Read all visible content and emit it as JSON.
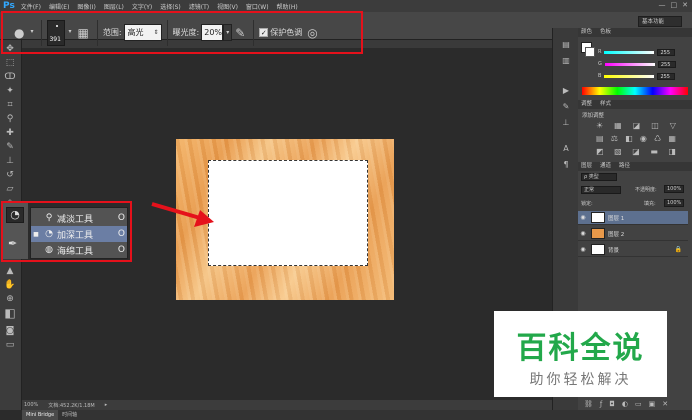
{
  "app": {
    "logo": "Ps"
  },
  "menu": [
    "文件(F)",
    "编辑(E)",
    "图像(I)",
    "图层(L)",
    "文字(Y)",
    "选择(S)",
    "滤镜(T)",
    "视图(V)",
    "窗口(W)",
    "帮助(H)"
  ],
  "window_controls": [
    "—",
    "□",
    "✕"
  ],
  "workspace": "基本功能",
  "options": {
    "brush_size": "391",
    "range_label": "范围:",
    "range_value": "高光",
    "exposure_label": "曝光度:",
    "exposure_value": "20%",
    "protect_tones_checked": true,
    "protect_tones_label": "保护色调"
  },
  "flyout": {
    "items": [
      {
        "label": "减淡工具",
        "key": "O",
        "icon": "dodge-icon",
        "active": false
      },
      {
        "label": "加深工具",
        "key": "O",
        "icon": "burn-icon",
        "active": true
      },
      {
        "label": "海绵工具",
        "key": "O",
        "icon": "sponge-icon",
        "active": false
      }
    ]
  },
  "color_panel": {
    "tabs": [
      "颜色",
      "色板"
    ],
    "r_label": "R",
    "g_label": "G",
    "b_label": "B",
    "r": "255",
    "g": "255",
    "b": "255"
  },
  "adjust_panel": {
    "tabs": [
      "调整",
      "样式"
    ],
    "add_label": "添加调整"
  },
  "layers_panel": {
    "tabs": [
      "图层",
      "通道",
      "路径"
    ],
    "filter": "ρ 类型",
    "blend_mode": "正常",
    "opacity_label": "不透明度:",
    "opacity": "100%",
    "lock_label": "锁定:",
    "fill_label": "填充:",
    "fill": "100%",
    "layers": [
      {
        "name": "图层 1",
        "selected": true,
        "thumb": "#ffffff"
      },
      {
        "name": "图层 2",
        "selected": false,
        "thumb": "#e8994a"
      },
      {
        "name": "背景",
        "selected": false,
        "thumb": "#ffffff"
      }
    ]
  },
  "status": {
    "zoom": "100%",
    "doc": "文档:452.2K/1.18M"
  },
  "bottom_tabs": [
    "Mini Bridge",
    "时间轴"
  ],
  "watermark": {
    "main": "百科全说",
    "sub": "助你轻松解决"
  },
  "colors": {
    "highlight": "#e5111b",
    "selection_blue": "#6b7ea4",
    "watermark_green": "#22a84a"
  }
}
